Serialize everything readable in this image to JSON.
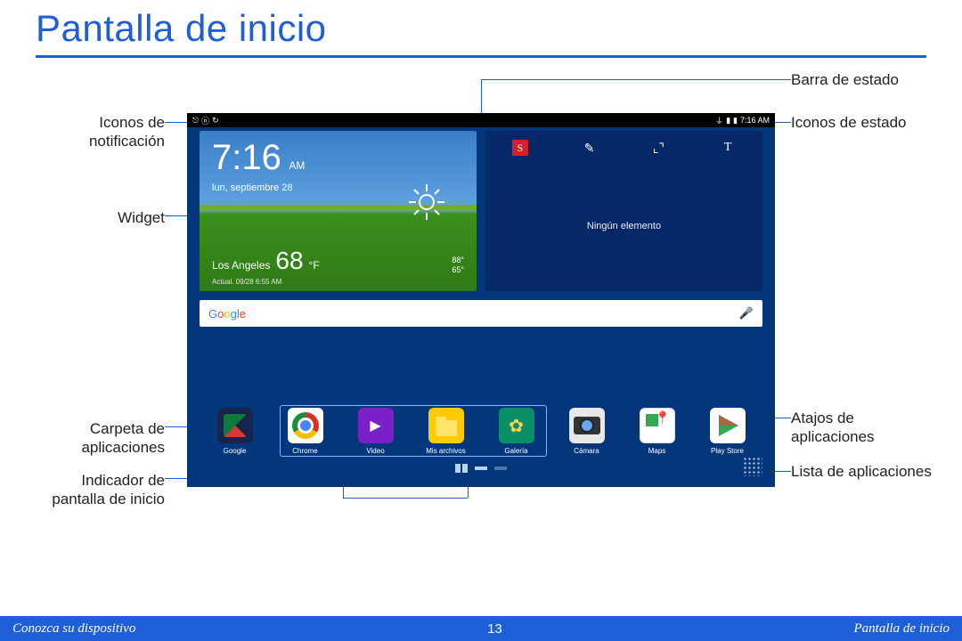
{
  "page_title": "Pantalla de inicio",
  "labels": {
    "notif_icons": "Iconos de notificación",
    "widget": "Widget",
    "app_folder": "Carpeta de aplicaciones",
    "page_indicator": "Indicador de pantalla de inicio",
    "status_bar": "Barra de estado",
    "status_icons": "Iconos de estado",
    "app_shortcuts": "Atajos de aplicaciones",
    "apps_list": "Lista de aplicaciones"
  },
  "status": {
    "time": "7:16 AM"
  },
  "weather": {
    "time": "7:16",
    "ampm": "AM",
    "date": "lun, septiembre 28",
    "city": "Los Angeles",
    "temp": "68",
    "unit": "°F",
    "hi": "88°",
    "lo": "65°",
    "updated": "Actual. 09/28 6:55 AM"
  },
  "note_widget": {
    "empty_msg": "Ningún elemento"
  },
  "search": {
    "brand_letters": [
      "G",
      "o",
      "o",
      "g",
      "l",
      "e"
    ]
  },
  "dock": [
    {
      "label": "Google",
      "cls": "folder"
    },
    {
      "label": "Chrome",
      "cls": "chrome"
    },
    {
      "label": "Video",
      "cls": "video"
    },
    {
      "label": "Mis archivos",
      "cls": "files"
    },
    {
      "label": "Galería",
      "cls": "gallery"
    },
    {
      "label": "Cámara",
      "cls": "camera"
    },
    {
      "label": "Maps",
      "cls": "maps"
    },
    {
      "label": "Play Store",
      "cls": "play"
    }
  ],
  "footer": {
    "left": "Conozca su dispositivo",
    "page": "13",
    "right": "Pantalla de inicio"
  }
}
